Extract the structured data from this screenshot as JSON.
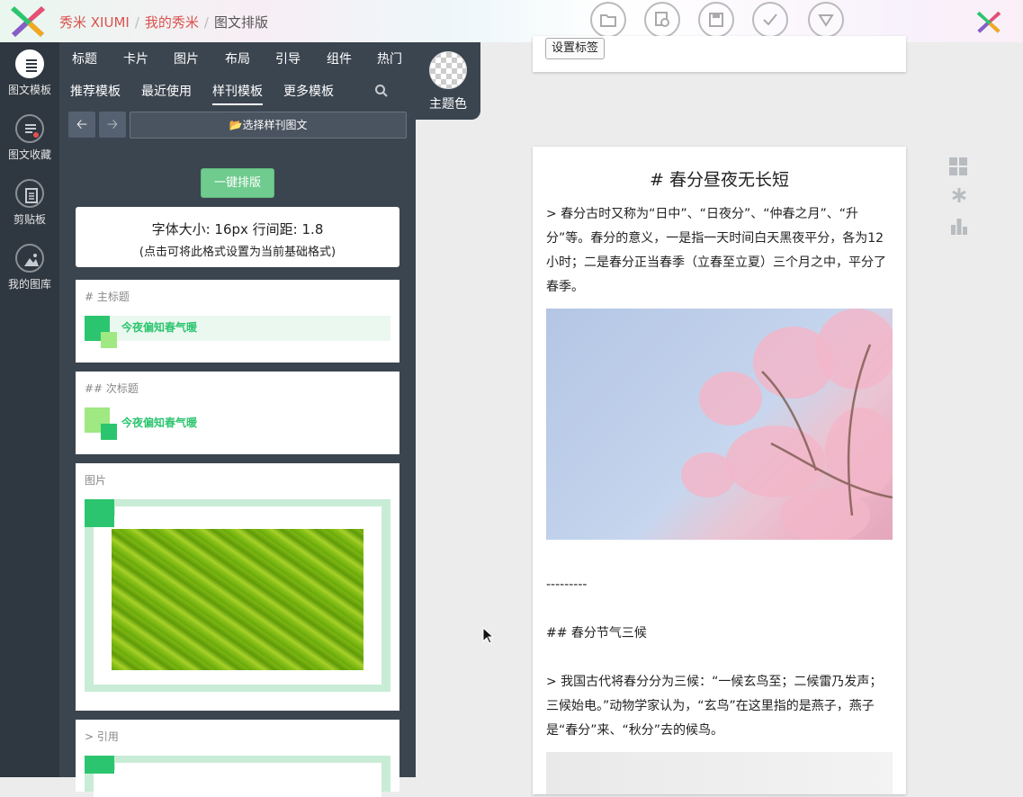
{
  "header": {
    "breadcrumb": [
      "秀米 XIUMI",
      "我的秀米",
      "图文排版"
    ]
  },
  "toolbar_icons": [
    "folder-icon",
    "preview-icon",
    "save-icon",
    "check-icon",
    "dropdown-icon"
  ],
  "leftbar": {
    "items": [
      {
        "label": "图文模板",
        "icon": "template-icon",
        "active": true
      },
      {
        "label": "图文收藏",
        "icon": "favorite-icon",
        "active": false
      },
      {
        "label": "剪贴板",
        "icon": "clipboard-icon",
        "active": false
      },
      {
        "label": "我的图库",
        "icon": "gallery-icon",
        "active": false
      }
    ]
  },
  "panel": {
    "category_tabs": [
      "标题",
      "卡片",
      "图片",
      "布局",
      "引导",
      "组件",
      "热门"
    ],
    "template_tabs": [
      "推荐模板",
      "最近使用",
      "样刊模板",
      "更多模板"
    ],
    "active_template_tab": "样刊模板",
    "choose_label": "选择样刊图文",
    "one_key_label": "一键排版",
    "font_info": {
      "line1": "字体大小: 16px 行间距: 1.8",
      "line2": "(点击可将此格式设置为当前基础格式)"
    },
    "cards": [
      {
        "label": "# 主标题",
        "text": "今夜偏知春气暖"
      },
      {
        "label": "## 次标题",
        "text": "今夜偏知春气暖"
      },
      {
        "label": "图片"
      },
      {
        "label": "> 引用"
      }
    ]
  },
  "theme": {
    "label": "主题色"
  },
  "preview": {
    "tag_button": "设置标签"
  },
  "document": {
    "title": "# 春分昼夜无长短",
    "para1": "> 春分古时又称为“日中”、“日夜分”、“仲春之月”、“升分”等。春分的意义，一是指一天时间白天黑夜平分，各为12小时；二是春分正当春季（立春至立夏）三个月之中，平分了春季。",
    "divider": "---------",
    "heading2": "## 春分节气三候",
    "para2": "> 我国古代将春分分为三候：“一候玄鸟至；二候雷乃发声；三候始电。”动物学家认为，“玄鸟”在这里指的是燕子，燕子是“春分”来、“秋分”去的候鸟。"
  },
  "colors": {
    "accent_green": "#2cc56f",
    "light_green": "#9fe882",
    "panel_bg": "#3b4550",
    "leftbar_bg": "#2f3740",
    "crumb_red": "#d9534f"
  }
}
